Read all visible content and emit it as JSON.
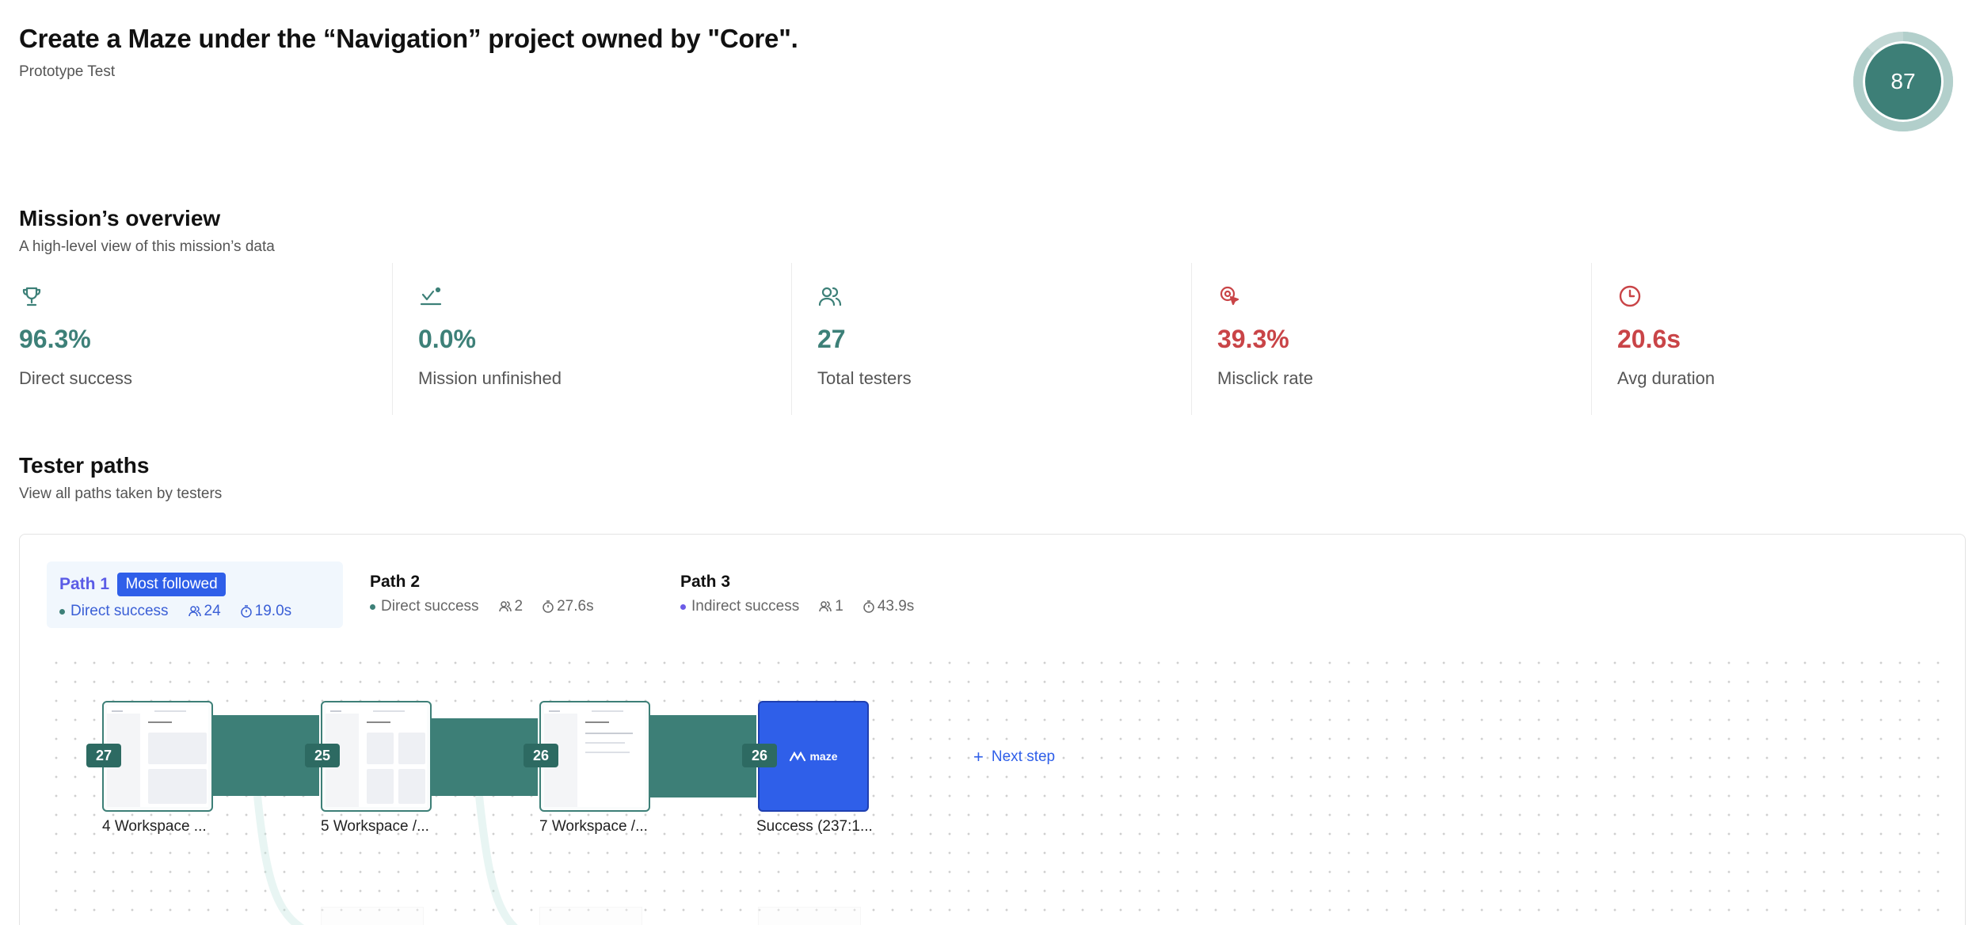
{
  "header": {
    "title": "Create a Maze under the “Navigation” project owned by \"Core\".",
    "subtitle": "Prototype Test",
    "score": "87"
  },
  "overview": {
    "title": "Mission’s overview",
    "subtitle": "A high-level view of this mission’s data",
    "stats": [
      {
        "value": "96.3%",
        "label": "Direct success",
        "icon": "trophy-icon",
        "color": "#3d8078"
      },
      {
        "value": "0.0%",
        "label": "Mission unfinished",
        "icon": "bail-out-icon",
        "color": "#3d8078"
      },
      {
        "value": "27",
        "label": "Total testers",
        "icon": "users-icon",
        "color": "#3d8078"
      },
      {
        "value": "39.3%",
        "label": "Misclick rate",
        "icon": "misclick-icon",
        "color": "#c94447"
      },
      {
        "value": "20.6s",
        "label": "Avg duration",
        "icon": "clock-icon",
        "color": "#c94447"
      }
    ]
  },
  "paths": {
    "title": "Tester paths",
    "subtitle": "View all paths taken by testers",
    "tabs": [
      {
        "name": "Path 1",
        "badge": "Most followed",
        "status": "Direct success",
        "testers": "24",
        "duration": "19.0s",
        "dot_color": "#3d8078"
      },
      {
        "name": "Path 2",
        "status": "Direct success",
        "testers": "2",
        "duration": "27.6s",
        "dot_color": "#3d8078"
      },
      {
        "name": "Path 3",
        "status": "Indirect success",
        "testers": "1",
        "duration": "43.9s",
        "dot_color": "#6c5ce7"
      }
    ],
    "steps": [
      {
        "count": "27",
        "label": "4 Workspace ..."
      },
      {
        "count": "25",
        "label": "5 Workspace /..."
      },
      {
        "count": "26",
        "label": "7 Workspace /..."
      },
      {
        "count": "26",
        "label": "Success (237:1..."
      }
    ],
    "success_logo_text": "maze",
    "next_step_label": "Next step"
  },
  "colors": {
    "accent_teal": "#3d7f77",
    "accent_blue": "#2f5fe9",
    "warning_red": "#c94447"
  }
}
